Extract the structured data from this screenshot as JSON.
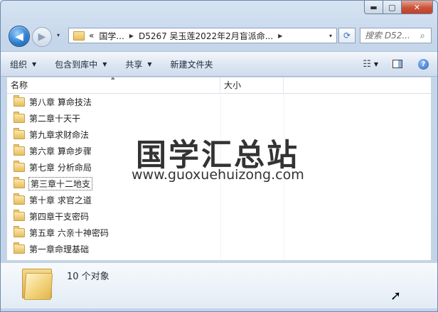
{
  "window": {
    "caption": {
      "minimize": "▬",
      "maximize": "▢",
      "close": "✕"
    }
  },
  "nav": {
    "back_glyph": "◀",
    "forward_glyph": "▶",
    "dropdown_glyph": "▾",
    "breadcrumbs": [
      "«",
      "国学...",
      "D5267 吴玉莲2022年2月盲派命..."
    ],
    "refresh_glyph": "⟳",
    "search_placeholder": "搜索 D52...",
    "search_icon_glyph": "⌕"
  },
  "toolbar": {
    "items": [
      "组织",
      "包含到库中",
      "共享",
      "新建文件夹"
    ],
    "views_glyph": "☷",
    "help_glyph": "?"
  },
  "columns": {
    "name": "名称",
    "size": "大小"
  },
  "folders": [
    "第八章 算命技法",
    "第二章十天干",
    "第九章求财命法",
    "第六章 算命步骤",
    "第七章 分析命局",
    "第三章十二地支",
    "第十章 求官之道",
    "第四章干支密码",
    "第五章 六亲十神密码",
    "第一章命理基础"
  ],
  "watermark": {
    "title": "国学汇总站",
    "url": "www.guoxuehuizong.com"
  },
  "status": {
    "count_text": "10 个对象"
  }
}
